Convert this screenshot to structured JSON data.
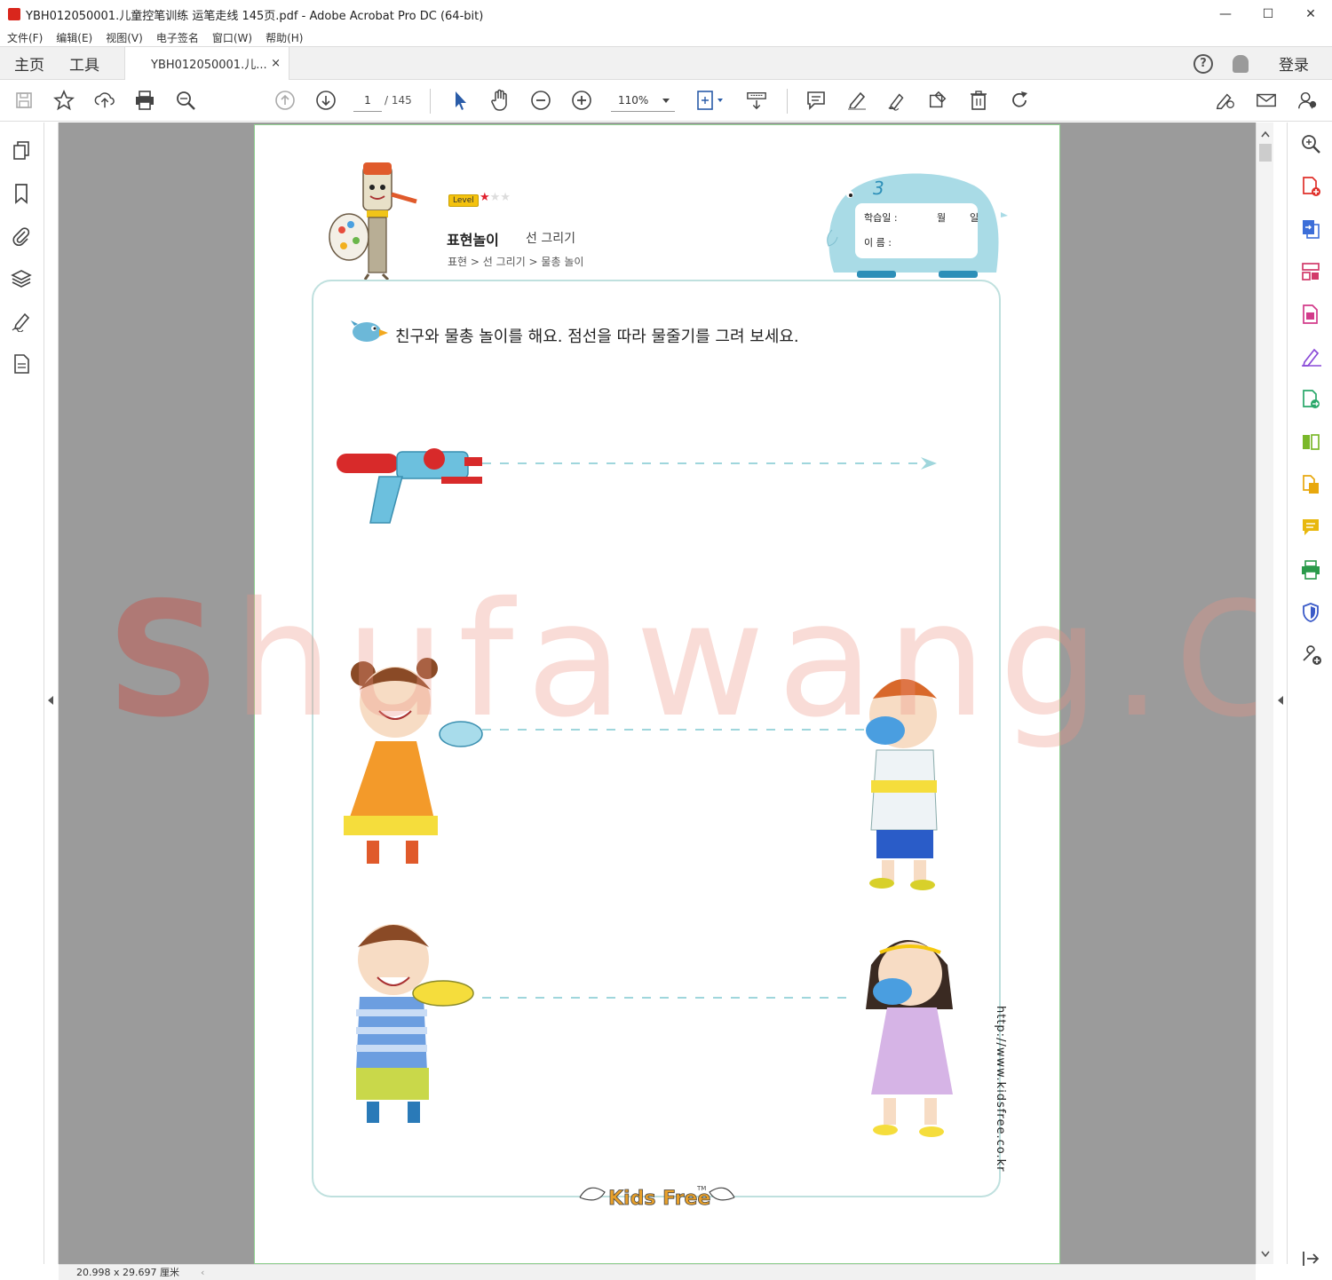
{
  "window": {
    "title": "YBH012050001.儿童控笔训练 运笔走线 145页.pdf - Adobe Acrobat Pro DC (64-bit)",
    "minimize": "—",
    "maximize": "☐",
    "close": "✕"
  },
  "menu": {
    "items": [
      "文件(F)",
      "编辑(E)",
      "视图(V)",
      "电子签名",
      "窗口(W)",
      "帮助(H)"
    ]
  },
  "tabs": {
    "home": "主页",
    "tools": "工具",
    "document": "YBH012050001.儿...",
    "close": "×",
    "help": "?",
    "login": "登录"
  },
  "toolbar": {
    "page_current": "1",
    "page_total": "/ 145",
    "zoom": "110%"
  },
  "status": {
    "dimensions": "20.998 x 29.697 厘米"
  },
  "worksheet": {
    "level_badge": "Level",
    "star_on": "★",
    "stars_off": "★★",
    "level_stars_filled": 1,
    "level_stars_total": 3,
    "title": "표현놀이",
    "subtitle": "선 그리기",
    "breadcrumb": "표현 > 선 그리기 > 물총 놀이",
    "number": "3",
    "date_label": "학습일 :",
    "month_label": "월",
    "day_label": "일",
    "name_label": "이  름 :",
    "instruction": "친구와 물총 놀이를 해요. 점선을 따라 물줄기를 그려 보세요.",
    "url": "http://www.kidsfree.co.kr",
    "logo": "Kids Free",
    "logo_tm": "TM"
  },
  "watermark": {
    "first": "S",
    "rest": "hufawang.CN"
  },
  "colors": {
    "accent_red": "#d9261c",
    "panel_border": "#bfe0de",
    "dash": "#9fd6dc",
    "elephant": "#a9dbe6",
    "page_border": "#8fd08f"
  }
}
